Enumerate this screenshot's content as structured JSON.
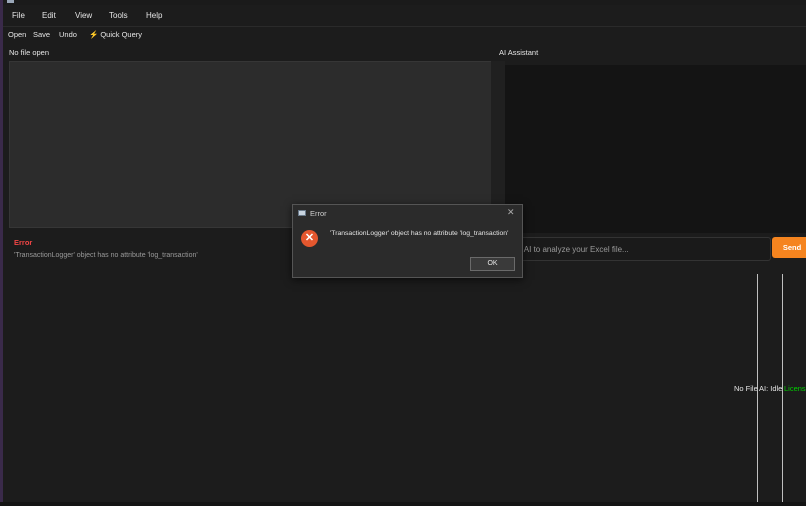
{
  "menu": [
    "File",
    "Edit",
    "View",
    "Tools",
    "Help"
  ],
  "toolbar": {
    "open": "Open",
    "save": "Save",
    "undo": "Undo",
    "quick_query": "Quick Query",
    "quick_query_icon": "lightning-icon"
  },
  "file_panel": {
    "label": "No file open"
  },
  "error_panel": {
    "title": "Error",
    "message": "'TransactionLogger' object has no attribute 'log_transaction'"
  },
  "ai_panel": {
    "label": "AI Assistant",
    "input_placeholder": "k AI to analyze your Excel file...",
    "send_label": "Send"
  },
  "status_bar": {
    "file": "No File",
    "ai": "AI: Idle",
    "license": "License"
  },
  "dialog": {
    "title": "Error",
    "message": "'TransactionLogger' object has no attribute 'log_transaction'",
    "ok_label": "OK",
    "icon": "error-icon"
  },
  "colors": {
    "accent": "#f5841f",
    "error": "#f04545",
    "license": "#00d000"
  }
}
